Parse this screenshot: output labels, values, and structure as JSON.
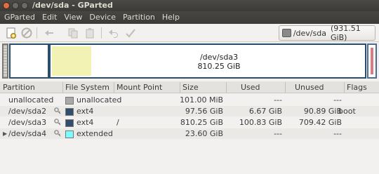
{
  "window": {
    "title": "/dev/sda - GParted"
  },
  "menu": [
    "GParted",
    "Edit",
    "View",
    "Device",
    "Partition",
    "Help"
  ],
  "toolbar": {
    "icons": [
      "new-icon",
      "delete-icon",
      "resize-icon",
      "copy-icon",
      "paste-icon",
      "undo-icon",
      "apply-icon"
    ],
    "device": "/dev/sda",
    "device_size": "(931.51 GiB)"
  },
  "diskmap": {
    "selected_name": "/dev/sda3",
    "selected_size": "810.25 GiB",
    "used_fraction": 0.124
  },
  "columns": [
    "Partition",
    "File System",
    "Mount Point",
    "Size",
    "Used",
    "Unused",
    "Flags"
  ],
  "rows": [
    {
      "partition": "unallocated",
      "fs": "unallocated",
      "fs_color": "#a9a9a9",
      "mount": "",
      "size": "101.00 MiB",
      "used": "---",
      "unused": "---",
      "flags": "",
      "key": false,
      "expander": false
    },
    {
      "partition": "/dev/sda2",
      "fs": "ext4",
      "fs_color": "#314e6c",
      "mount": "",
      "size": "97.56 GiB",
      "used": "6.67 GiB",
      "unused": "90.89 GiB",
      "flags": "boot",
      "key": true,
      "expander": false
    },
    {
      "partition": "/dev/sda3",
      "fs": "ext4",
      "fs_color": "#314e6c",
      "mount": "/",
      "size": "810.25 GiB",
      "used": "100.83 GiB",
      "unused": "709.42 GiB",
      "flags": "",
      "key": true,
      "expander": false
    },
    {
      "partition": "/dev/sda4",
      "fs": "extended",
      "fs_color": "#7dfcfe",
      "mount": "",
      "size": "23.60 GiB",
      "used": "---",
      "unused": "---",
      "flags": "",
      "key": true,
      "expander": true
    }
  ]
}
